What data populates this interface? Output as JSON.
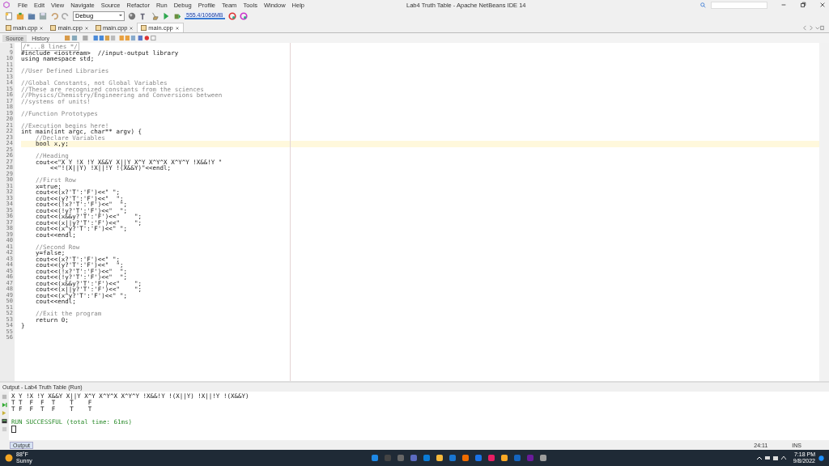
{
  "window": {
    "title": "Lab4 Truth Table - Apache NetBeans IDE 14"
  },
  "menu": [
    "File",
    "Edit",
    "View",
    "Navigate",
    "Source",
    "Refactor",
    "Run",
    "Debug",
    "Profile",
    "Team",
    "Tools",
    "Window",
    "Help"
  ],
  "toolbar": {
    "configuration": "Debug",
    "memory": "555.4/1066MB"
  },
  "editor_tabs": [
    {
      "label": "main.cpp",
      "selected": false
    },
    {
      "label": "main.cpp",
      "selected": false
    },
    {
      "label": "main.cpp",
      "selected": false
    },
    {
      "label": "main.cpp",
      "selected": true
    }
  ],
  "view_tabs": [
    {
      "label": "Source",
      "selected": true
    },
    {
      "label": "History",
      "selected": false
    }
  ],
  "code_lines": [
    {
      "number": "1",
      "text": "/*...8 lines */",
      "kind": "folded",
      "current": false
    },
    {
      "number": "9",
      "text": "#include <iostream>  //input-output library",
      "kind": "code",
      "current": false
    },
    {
      "number": "10",
      "text": "using namespace std;",
      "kind": "code",
      "current": false
    },
    {
      "number": "11",
      "kind": "blank",
      "current": false
    },
    {
      "number": "12",
      "text": "//User Defined Libraries",
      "kind": "comment",
      "current": false
    },
    {
      "number": "13",
      "kind": "blank",
      "current": false
    },
    {
      "number": "14",
      "text": "//Global Constants, not Global Variables",
      "kind": "comment",
      "current": false
    },
    {
      "number": "15",
      "text": "//These are recognized constants from the sciences",
      "kind": "comment",
      "current": false
    },
    {
      "number": "16",
      "text": "//Physics/Chemistry/Engineering and Conversions between",
      "kind": "comment",
      "current": false
    },
    {
      "number": "17",
      "text": "//systems of units!",
      "kind": "comment",
      "current": false
    },
    {
      "number": "18",
      "kind": "blank",
      "current": false
    },
    {
      "number": "19",
      "text": "//Function Prototypes",
      "kind": "comment",
      "current": false
    },
    {
      "number": "20",
      "kind": "blank",
      "current": false
    },
    {
      "number": "21",
      "text": "//Execution begins here!",
      "kind": "comment",
      "current": false
    },
    {
      "number": "22",
      "text": "int main(int argc, char** argv) {",
      "kind": "code",
      "current": false
    },
    {
      "number": "23",
      "text": "    //Declare Variables",
      "kind": "comment",
      "current": false
    },
    {
      "number": "24",
      "text": "    bool x,y;",
      "kind": "code",
      "current": true
    },
    {
      "number": "25",
      "kind": "blank",
      "current": false
    },
    {
      "number": "26",
      "text": "    //Heading",
      "kind": "comment",
      "current": false
    },
    {
      "number": "27",
      "text": "    cout<<\"X Y !X !Y X&&Y X||Y X^Y X^Y^X X^Y^Y !X&&!Y \"",
      "kind": "code",
      "current": false
    },
    {
      "number": "28",
      "text": "        <<\"!(X||Y) !X||!Y !(X&&Y)\"<<endl;",
      "kind": "code",
      "current": false
    },
    {
      "number": "29",
      "kind": "blank",
      "current": false
    },
    {
      "number": "30",
      "text": "    //First Row",
      "kind": "comment",
      "current": false
    },
    {
      "number": "31",
      "text": "    x=true;",
      "kind": "code",
      "current": false
    },
    {
      "number": "32",
      "text": "    cout<<(x?'T':'F')<<\" \";",
      "kind": "code",
      "current": false
    },
    {
      "number": "33",
      "text": "    cout<<(y?'T':'F')<<\"  \";",
      "kind": "code",
      "current": false
    },
    {
      "number": "34",
      "text": "    cout<<(!x?'T':'F')<<\"  \";",
      "kind": "code",
      "current": false
    },
    {
      "number": "35",
      "text": "    cout<<(!y?'T':'F')<<\"  \";",
      "kind": "code",
      "current": false
    },
    {
      "number": "36",
      "text": "    cout<<(x&&y?'T':'F')<<\"    \";",
      "kind": "code",
      "current": false
    },
    {
      "number": "37",
      "text": "    cout<<(x||y?'T':'F')<<\"    \";",
      "kind": "code",
      "current": false
    },
    {
      "number": "38",
      "text": "    cout<<(x^y?'T':'F')<<\" \";",
      "kind": "code",
      "current": false
    },
    {
      "number": "39",
      "text": "    cout<<endl;",
      "kind": "code",
      "current": false
    },
    {
      "number": "40",
      "kind": "blank",
      "current": false
    },
    {
      "number": "41",
      "text": "    //Second Row",
      "kind": "comment",
      "current": false
    },
    {
      "number": "42",
      "text": "    y=false;",
      "kind": "code",
      "current": false
    },
    {
      "number": "43",
      "text": "    cout<<(x?'T':'F')<<\" \";",
      "kind": "code",
      "current": false
    },
    {
      "number": "44",
      "text": "    cout<<(y?'T':'F')<<\"  \";",
      "kind": "code",
      "current": false
    },
    {
      "number": "45",
      "text": "    cout<<(!x?'T':'F')<<\"  \";",
      "kind": "code",
      "current": false
    },
    {
      "number": "46",
      "text": "    cout<<(!y?'T':'F')<<\"  \";",
      "kind": "code",
      "current": false
    },
    {
      "number": "47",
      "text": "    cout<<(x&&y?'T':'F')<<\"    \";",
      "kind": "code",
      "current": false
    },
    {
      "number": "48",
      "text": "    cout<<(x||y?'T':'F')<<\"    \";",
      "kind": "code",
      "current": false
    },
    {
      "number": "49",
      "text": "    cout<<(x^y?'T':'F')<<\" \";",
      "kind": "code",
      "current": false
    },
    {
      "number": "50",
      "text": "    cout<<endl;",
      "kind": "code",
      "current": false
    },
    {
      "number": "51",
      "kind": "blank",
      "current": false
    },
    {
      "number": "52",
      "text": "    //Exit the program",
      "kind": "comment",
      "current": false
    },
    {
      "number": "53",
      "text": "    return 0;",
      "kind": "code",
      "current": false
    },
    {
      "number": "54",
      "text": "}",
      "kind": "code",
      "current": false
    },
    {
      "number": "55",
      "kind": "blank",
      "current": false
    },
    {
      "number": "56",
      "kind": "blank",
      "current": false
    }
  ],
  "output": {
    "title": "Output - Lab4 Truth Table (Run)",
    "lines": [
      {
        "text": "X Y !X !Y X&&Y X||Y X^Y X^Y^X X^Y^Y !X&&!Y !(X||Y) !X||!Y !(X&&Y)",
        "kind": "plain"
      },
      {
        "text": "T T  F  F  T    T    F",
        "kind": "plain"
      },
      {
        "text": "T F  F  T  F    T    T",
        "kind": "plain"
      },
      {
        "kind": "blank"
      },
      {
        "text": "RUN SUCCESSFUL (total time: 61ms)",
        "kind": "success"
      }
    ]
  },
  "bottom_tab": "Output",
  "status_bar": {
    "position": "24:11",
    "mode": "INS"
  },
  "taskbar": {
    "temperature": "88°F",
    "weather": "Sunny",
    "time": "7:18 PM",
    "date": "9/8/2022"
  }
}
